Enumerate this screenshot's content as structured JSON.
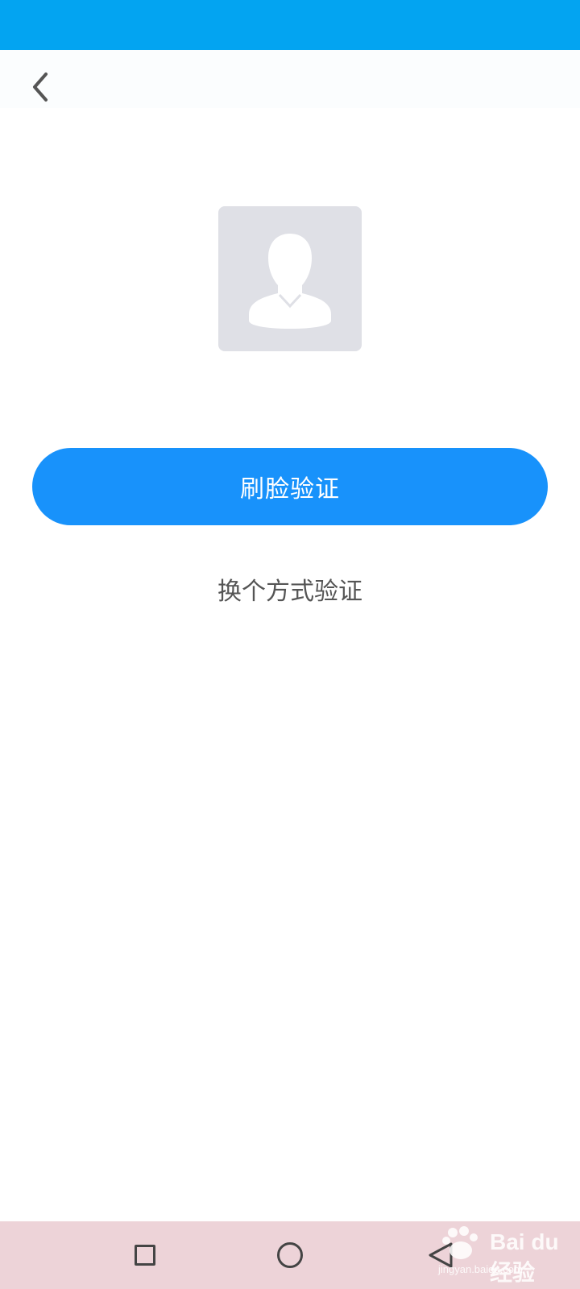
{
  "theme": {
    "status_bar_color": "#03a4f1",
    "primary_button_color": "#1892fb",
    "avatar_bg_color": "#dfe0e6",
    "avatar_silhouette_color": "#ffffff",
    "nav_bar_color": "#edd3d8"
  },
  "header": {
    "back_icon": "chevron-left-icon"
  },
  "avatar": {
    "icon": "user-silhouette-icon"
  },
  "actions": {
    "face_verify_label": "刷脸验证",
    "switch_method_label": "换个方式验证"
  },
  "system_nav": {
    "recent_icon": "square-icon",
    "home_icon": "circle-icon",
    "back_icon": "triangle-back-icon"
  },
  "watermark": {
    "text": "Bai du 经验",
    "subtext": "jingyan.baidu.com"
  }
}
